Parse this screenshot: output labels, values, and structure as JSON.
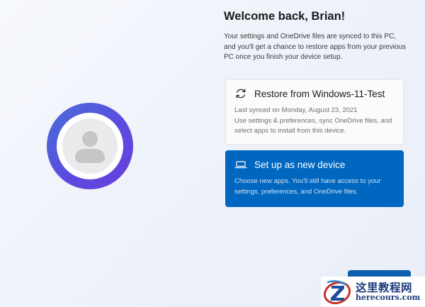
{
  "welcome": {
    "title": "Welcome back, Brian!",
    "subtitle": "Your settings and OneDrive files are synced to this PC, and you'll get a chance to restore apps from your previous PC once you finish your device setup."
  },
  "avatar": {
    "icon": "person-icon"
  },
  "options": {
    "restore": {
      "icon": "sync-icon",
      "title": "Restore from Windows-11-Test",
      "line1": "Last synced on Monday, August 23, 2021",
      "description": "Use settings & preferences, sync OneDrive files, and select apps to install from this device."
    },
    "new_device": {
      "icon": "laptop-icon",
      "title": "Set up as new device",
      "description": "Choose new apps. You'll still have access to your settings, preferences, and OneDrive files."
    }
  },
  "watermark": {
    "text_cn": "这里教程网",
    "url": "herecours.com"
  },
  "colors": {
    "accent": "#0067c0",
    "avatar_ring": "#5a4be0"
  }
}
